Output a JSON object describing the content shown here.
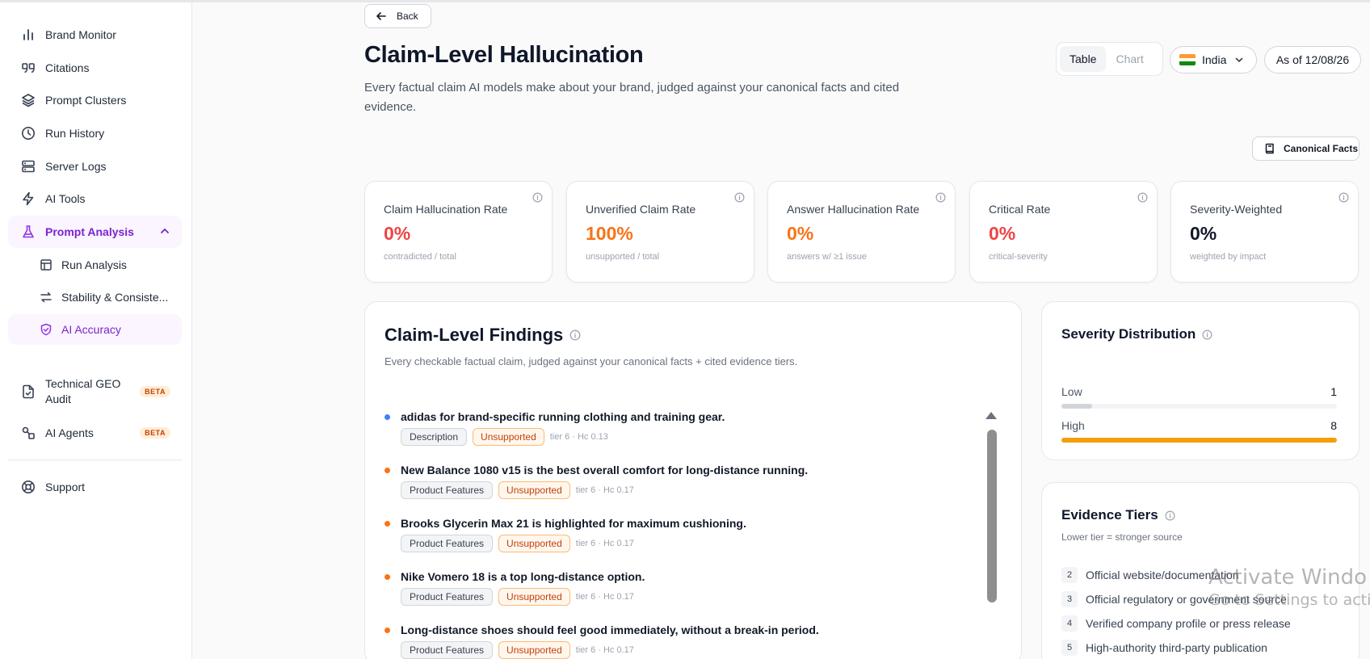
{
  "sidebar": {
    "items": [
      {
        "label": "Brand Monitor",
        "icon": "bar-chart-icon"
      },
      {
        "label": "Citations",
        "icon": "quote-icon"
      },
      {
        "label": "Prompt Clusters",
        "icon": "layers-icon"
      },
      {
        "label": "Run History",
        "icon": "clock-icon"
      },
      {
        "label": "Server Logs",
        "icon": "server-icon"
      },
      {
        "label": "AI Tools",
        "icon": "lightning-icon"
      },
      {
        "label": "Prompt Analysis",
        "icon": "flask-icon"
      },
      {
        "label": "Run Analysis",
        "icon": "table-icon"
      },
      {
        "label": "Stability & Consiste...",
        "icon": "arrows-icon"
      },
      {
        "label": "AI Accuracy",
        "icon": "shield-check-icon"
      },
      {
        "label": "Technical GEO Audit",
        "icon": "file-check-icon"
      },
      {
        "label": "AI Agents",
        "icon": "shapes-icon"
      },
      {
        "label": "Support",
        "icon": "lifebuoy-icon"
      }
    ],
    "beta_label": "BETA"
  },
  "header": {
    "back_label": "Back",
    "title": "Claim-Level Hallucination",
    "subtitle": "Every factual claim AI models make about your brand, judged against your canonical facts and cited evidence.",
    "view_toggle": {
      "table": "Table",
      "chart": "Chart",
      "selected": "Table"
    },
    "country": "India",
    "as_of": "As of 12/08/26",
    "canonical_facts_label": "Canonical Facts"
  },
  "kpis": [
    {
      "label": "Claim Hallucination Rate",
      "value": "0%",
      "sub": "contradicted / total",
      "color": "#ef4444"
    },
    {
      "label": "Unverified Claim Rate",
      "value": "100%",
      "sub": "unsupported / total",
      "color": "#f97316"
    },
    {
      "label": "Answer Hallucination Rate",
      "value": "0%",
      "sub": "answers w/ ≥1 issue",
      "color": "#f97316"
    },
    {
      "label": "Critical Rate",
      "value": "0%",
      "sub": "critical-severity",
      "color": "#ef4444"
    },
    {
      "label": "Severity-Weighted",
      "value": "0%",
      "sub": "weighted by impact",
      "color": "#111827"
    }
  ],
  "findings": {
    "title": "Claim-Level Findings",
    "subtitle": "Every checkable factual claim, judged against your canonical facts + cited evidence tiers.",
    "claims": [
      {
        "text": "adidas for brand-specific running clothing and training gear.",
        "category": "Description",
        "status": "Unsupported",
        "meta": "tier 6 · Hc 0.13",
        "dot_color": "#3b82f6"
      },
      {
        "text": "New Balance 1080 v15 is the best overall comfort for long-distance running.",
        "category": "Product Features",
        "status": "Unsupported",
        "meta": "tier 6 · Hc 0.17",
        "dot_color": "#f97316"
      },
      {
        "text": "Brooks Glycerin Max 21 is highlighted for maximum cushioning.",
        "category": "Product Features",
        "status": "Unsupported",
        "meta": "tier 6 · Hc 0.17",
        "dot_color": "#f97316"
      },
      {
        "text": "Nike Vomero 18 is a top long-distance option.",
        "category": "Product Features",
        "status": "Unsupported",
        "meta": "tier 6 · Hc 0.17",
        "dot_color": "#f97316"
      },
      {
        "text": "Long-distance shoes should feel good immediately, without a break-in period.",
        "category": "Product Features",
        "status": "Unsupported",
        "meta": "tier 6 · Hc 0.17",
        "dot_color": "#f97316"
      }
    ]
  },
  "severity": {
    "title": "Severity Distribution",
    "rows": [
      {
        "label": "Low",
        "count": "1",
        "fraction": 0.111,
        "color": "#d1d5db"
      },
      {
        "label": "High",
        "count": "8",
        "fraction": 1.0,
        "color": "#f59e0b"
      }
    ]
  },
  "tiers": {
    "title": "Evidence Tiers",
    "subtitle": "Lower tier = stronger source",
    "items": [
      {
        "num": "2",
        "label": "Official website/documentation"
      },
      {
        "num": "3",
        "label": "Official regulatory or government source"
      },
      {
        "num": "4",
        "label": "Verified company profile or press release"
      },
      {
        "num": "5",
        "label": "High-authority third-party publication"
      }
    ]
  },
  "watermark": {
    "line1": "Activate Windo",
    "line2": "Go to Settings to acti"
  },
  "colors": {
    "accent": "#9333ea",
    "danger": "#ef4444",
    "warning": "#f97316"
  }
}
